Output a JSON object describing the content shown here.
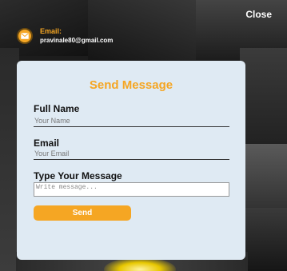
{
  "header": {
    "close_label": "Close"
  },
  "contact": {
    "email_label": "Email:",
    "email_value": "pravinale80@gmail.com",
    "icon": "mail-icon"
  },
  "form": {
    "title": "Send Message",
    "full_name": {
      "label": "Full Name",
      "placeholder": "Your Name",
      "value": ""
    },
    "email": {
      "label": "Email",
      "placeholder": "Your Email",
      "value": ""
    },
    "message": {
      "label": "Type Your Message",
      "placeholder": "Write message...",
      "value": ""
    },
    "submit_label": "Send"
  },
  "colors": {
    "accent": "#f5a623",
    "modal_bg": "#dfeaf3",
    "backdrop": "#1c1c1c"
  }
}
